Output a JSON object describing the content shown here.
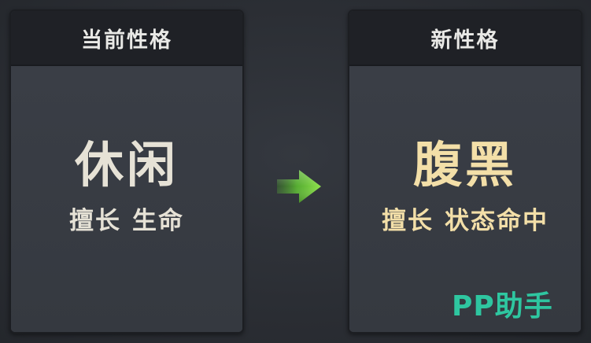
{
  "current_panel": {
    "header": "当前性格",
    "trait_name": "休闲",
    "desc_prefix": "擅长",
    "desc_value": "生命",
    "trait_color": "#e6e2d6"
  },
  "new_panel": {
    "header": "新性格",
    "trait_name": "腹黑",
    "desc_prefix": "擅长",
    "desc_value": "状态命中",
    "trait_color": "#f3dfa8"
  },
  "arrow": {
    "icon": "arrow-right-icon",
    "color": "#6fd13a"
  },
  "watermark": {
    "text": "PP助手",
    "color": "#2ec6a0"
  }
}
